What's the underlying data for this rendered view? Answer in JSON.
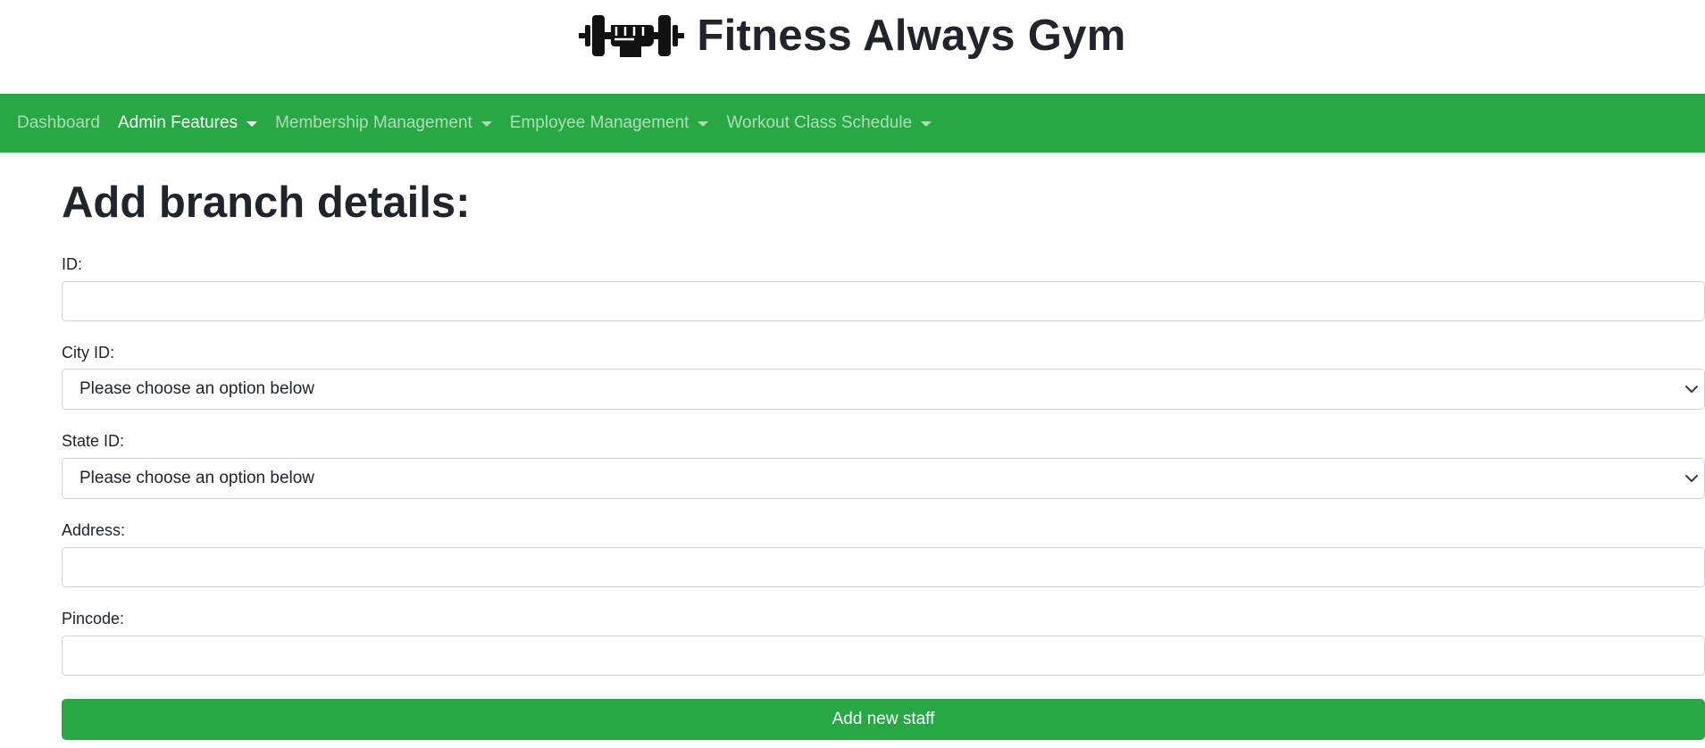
{
  "header": {
    "title": "Fitness Always Gym",
    "logo_icon": "dumbbell-fist-icon"
  },
  "nav": {
    "items": [
      {
        "label": "Dashboard",
        "dropdown": false,
        "active": false
      },
      {
        "label": "Admin Features",
        "dropdown": true,
        "active": true
      },
      {
        "label": "Membership Management",
        "dropdown": true,
        "active": false
      },
      {
        "label": "Employee Management",
        "dropdown": true,
        "active": false
      },
      {
        "label": "Workout Class Schedule",
        "dropdown": true,
        "active": false
      }
    ]
  },
  "form": {
    "title": "Add branch details:",
    "fields": {
      "id": {
        "label": "ID:",
        "value": ""
      },
      "city_id": {
        "label": "City ID:",
        "selected": "Please choose an option below"
      },
      "state_id": {
        "label": "State ID:",
        "selected": "Please choose an option below"
      },
      "address": {
        "label": "Address:",
        "value": ""
      },
      "pincode": {
        "label": "Pincode:",
        "value": ""
      }
    },
    "submit_label": "Add new staff"
  },
  "colors": {
    "brand_green": "#28a745",
    "text_dark": "#212529",
    "input_border": "#ced4da"
  }
}
